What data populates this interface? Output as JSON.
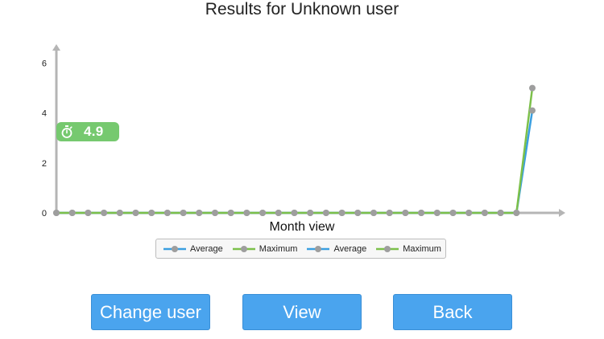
{
  "page": {
    "title": "Results for Unknown user"
  },
  "badge": {
    "icon": "stopwatch-icon",
    "value": "4.9"
  },
  "legend": {
    "items": [
      {
        "label": "Average",
        "color": "#3a9fe0"
      },
      {
        "label": "Maximum",
        "color": "#7cc04a"
      },
      {
        "label": "Average",
        "color": "#3a9fe0"
      },
      {
        "label": "Maximum",
        "color": "#7cc04a"
      }
    ]
  },
  "buttons": {
    "change_user": "Change user",
    "view": "View",
    "back": "Back"
  },
  "colors": {
    "average": "#3a9fe0",
    "maximum": "#7cc04a",
    "marker": "#9e9e9e",
    "axis": "#b5b5b5",
    "badge": "#76c96f",
    "button": "#4aa4ee"
  },
  "chart_data": {
    "type": "line",
    "title": "",
    "xlabel": "Month view",
    "ylabel": "",
    "ylim": [
      0,
      6.5
    ],
    "yticks": [
      0,
      2,
      4,
      6
    ],
    "grid": false,
    "legend_position": "bottom",
    "x": [
      1,
      2,
      3,
      4,
      5,
      6,
      7,
      8,
      9,
      10,
      11,
      12,
      13,
      14,
      15,
      16,
      17,
      18,
      19,
      20,
      21,
      22,
      23,
      24,
      25,
      26,
      27,
      28,
      29,
      30,
      31
    ],
    "series": [
      {
        "name": "Average",
        "color": "#3a9fe0",
        "values": [
          0,
          0,
          0,
          0,
          0,
          0,
          0,
          0,
          0,
          0,
          0,
          0,
          0,
          0,
          0,
          0,
          0,
          0,
          0,
          0,
          0,
          0,
          0,
          0,
          0,
          0,
          0,
          0,
          0,
          0,
          4.1
        ]
      },
      {
        "name": "Maximum",
        "color": "#7cc04a",
        "values": [
          0,
          0,
          0,
          0,
          0,
          0,
          0,
          0,
          0,
          0,
          0,
          0,
          0,
          0,
          0,
          0,
          0,
          0,
          0,
          0,
          0,
          0,
          0,
          0,
          0,
          0,
          0,
          0,
          0,
          0,
          5.0
        ]
      }
    ]
  }
}
